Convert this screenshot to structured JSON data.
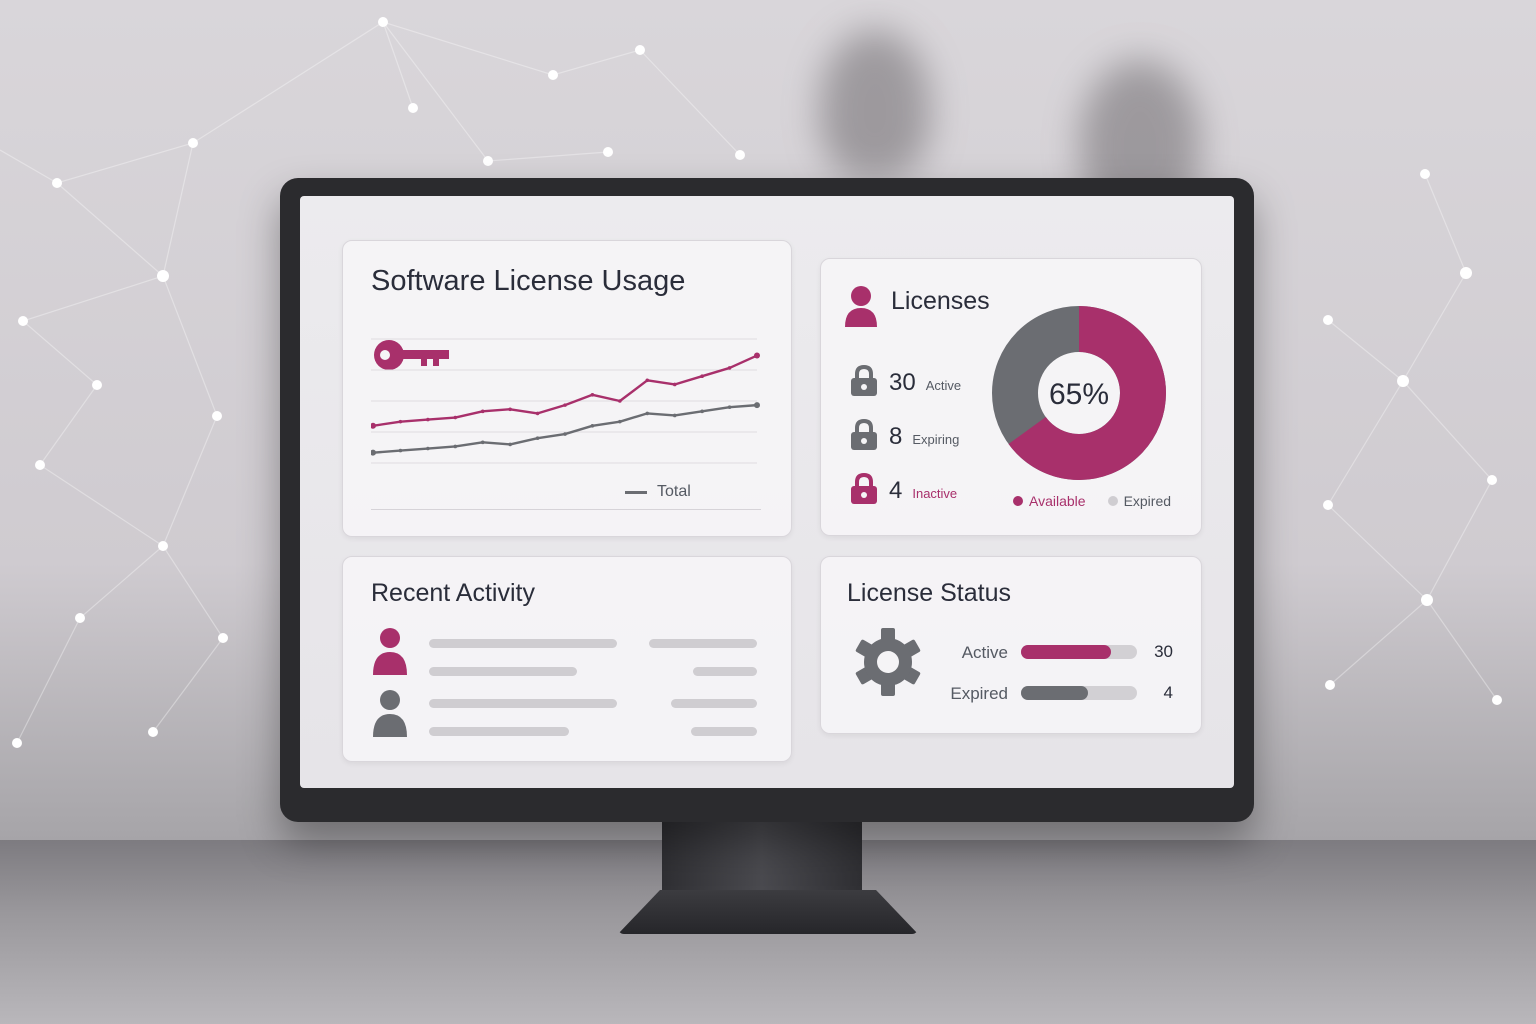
{
  "colors": {
    "accent": "#a8306b",
    "gray": "#6b6d72",
    "track": "#d2d0d4"
  },
  "usage_card": {
    "title": "Software License Usage",
    "icon": "key-icon",
    "legend_label": "Total"
  },
  "chart_data": {
    "type": "line",
    "title": "Software License Usage",
    "x": [
      1,
      2,
      3,
      4,
      5,
      6,
      7,
      8,
      9,
      10,
      11,
      12,
      13,
      14,
      15
    ],
    "series": [
      {
        "color": "#a8306b",
        "values": [
          18,
          20,
          21,
          22,
          25,
          26,
          24,
          28,
          33,
          30,
          40,
          38,
          42,
          46,
          52
        ]
      },
      {
        "name": "Total",
        "color": "#6b6d72",
        "values": [
          5,
          6,
          7,
          8,
          10,
          9,
          12,
          14,
          18,
          20,
          24,
          23,
          25,
          27,
          28
        ]
      }
    ],
    "ylim": [
      0,
      60
    ],
    "grid": true,
    "legend": "bottom-right"
  },
  "licenses_card": {
    "title": "Licenses",
    "icon": "user-icon",
    "rows": [
      {
        "value": "30",
        "label": "Active",
        "icon": "lock-icon"
      },
      {
        "value": "8",
        "label": "Expiring",
        "icon": "lock-icon"
      },
      {
        "value": "4",
        "label": "Inactive",
        "icon": "lock-icon"
      }
    ],
    "donut": {
      "center_text": "65%",
      "available_fraction": 0.65
    },
    "legend": [
      {
        "label": "Available",
        "color": "#a8306b"
      },
      {
        "label": "Expired",
        "color": "#cfcdd1"
      }
    ]
  },
  "activity_card": {
    "title": "Recent Activity",
    "users": [
      {
        "icon": "user-icon",
        "color": "#a8306b"
      },
      {
        "icon": "user-icon",
        "color": "#6b6d72"
      }
    ]
  },
  "status_card": {
    "title": "License Status",
    "icon": "gear-icon",
    "rows": [
      {
        "label": "Active",
        "value": "30",
        "fill": 0.78,
        "color": "#a8306b"
      },
      {
        "label": "Expired",
        "value": "4",
        "fill": 0.58,
        "color": "#6b6d72"
      }
    ]
  }
}
